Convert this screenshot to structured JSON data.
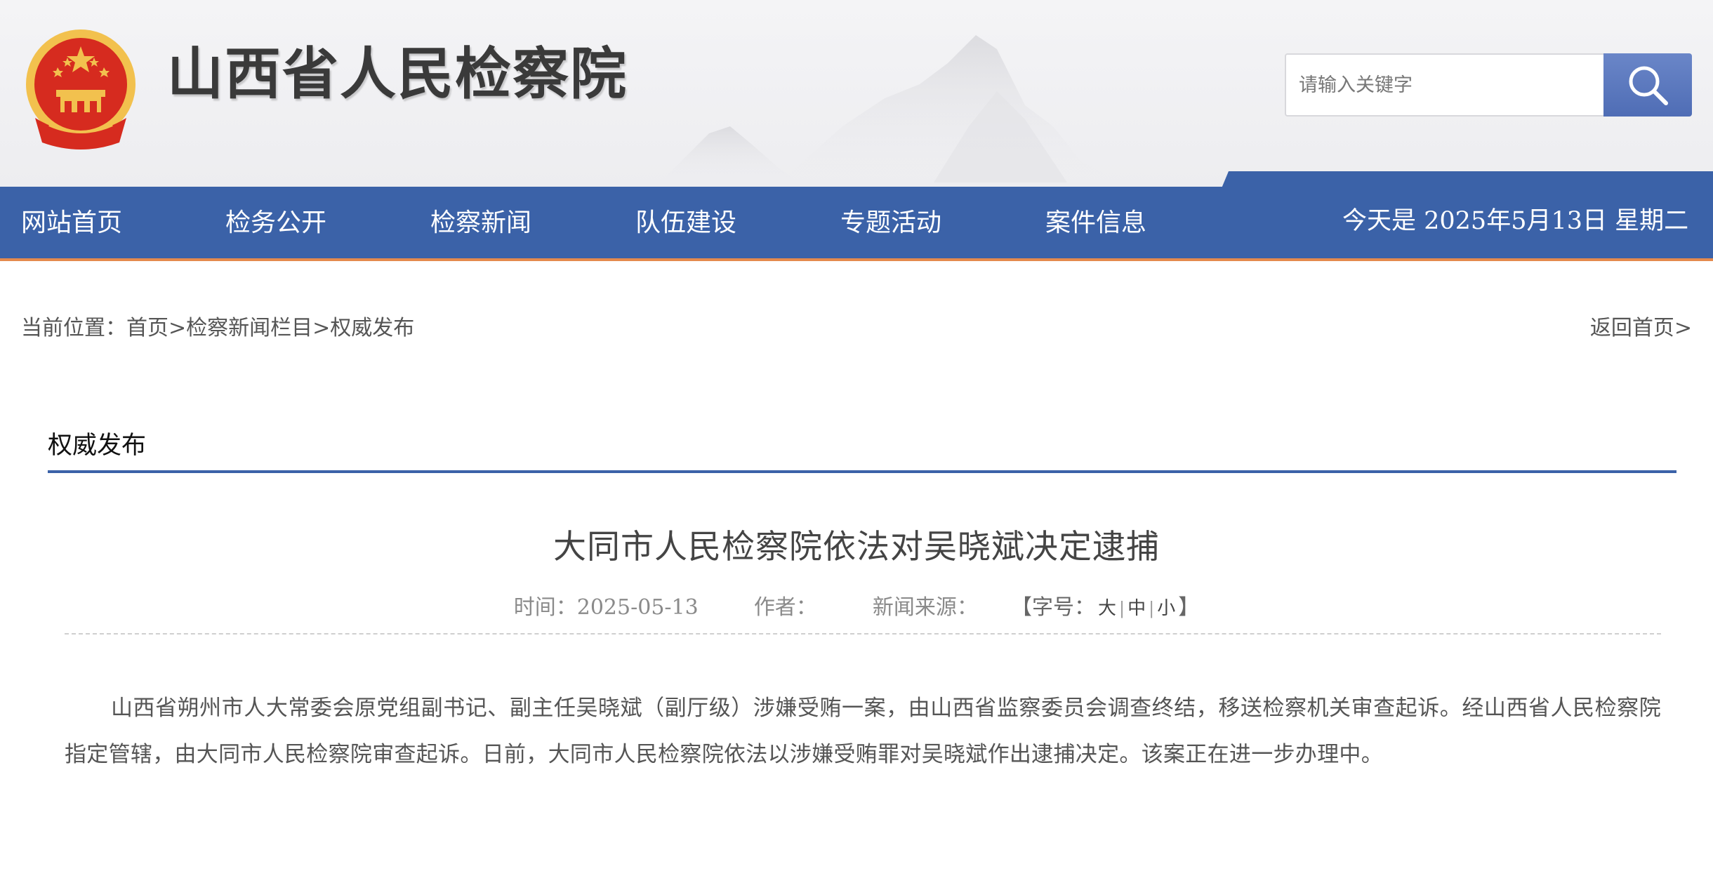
{
  "header": {
    "site_title": "山西省人民检察院",
    "search": {
      "placeholder": "请输入关键字",
      "button_icon": "search-icon"
    }
  },
  "nav": {
    "items": [
      {
        "label": "网站首页"
      },
      {
        "label": "检务公开"
      },
      {
        "label": "检察新闻"
      },
      {
        "label": "队伍建设"
      },
      {
        "label": "专题活动"
      },
      {
        "label": "案件信息"
      }
    ],
    "date_text": "今天是 2025年5月13日 星期二"
  },
  "breadcrumb": {
    "prefix": "当前位置：",
    "crumbs": [
      {
        "label": "首页"
      },
      {
        "label": "检察新闻栏目"
      },
      {
        "label": "权威发布"
      }
    ],
    "separator": ">",
    "back_home": "返回首页>"
  },
  "section": {
    "title": "权威发布"
  },
  "article": {
    "title": "大同市人民检察院依法对吴晓斌决定逮捕",
    "meta": {
      "time_label": "时间：",
      "time_value": "2025-05-13",
      "author_label": "作者：",
      "author_value": "",
      "source_label": "新闻来源：",
      "source_value": "",
      "font_size_open": "【字号：",
      "font_size_large": "大",
      "font_size_medium": "中",
      "font_size_small": "小",
      "font_size_close": "】",
      "divider": "|"
    },
    "body": "山西省朔州市人大常委会原党组副书记、副主任吴晓斌（副厅级）涉嫌受贿一案，由山西省监察委员会调查终结，移送检察机关审查起诉。经山西省人民检察院指定管辖，由大同市人民检察院审查起诉。日前，大同市人民检察院依法以涉嫌受贿罪对吴晓斌作出逮捕决定。该案正在进一步办理中。"
  },
  "colors": {
    "nav_blue": "#3b62a8",
    "nav_accent_orange": "#e48a4e",
    "search_button": "#5a78bd",
    "emblem_red": "#d62b1f",
    "emblem_gold": "#f2c14e"
  }
}
